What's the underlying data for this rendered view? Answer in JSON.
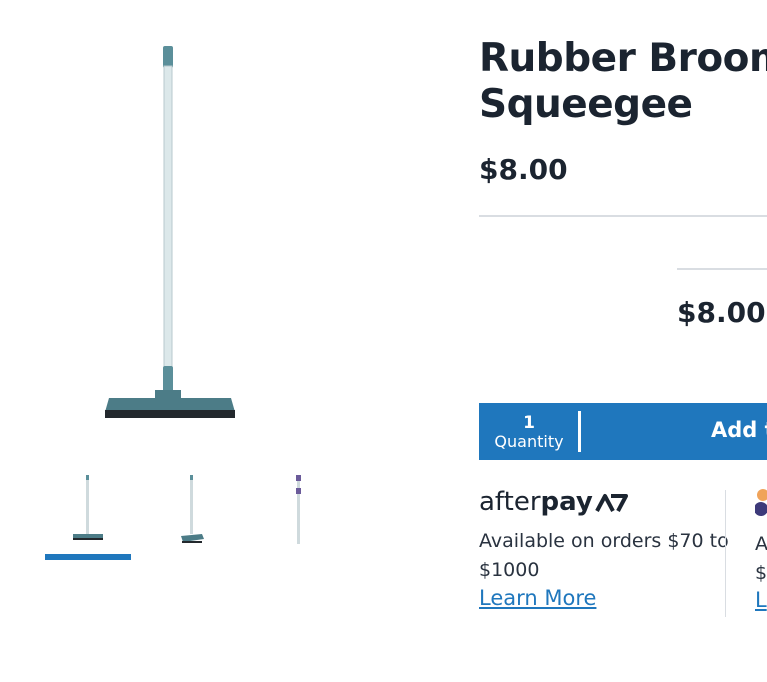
{
  "product": {
    "title_line1": "Rubber Broom",
    "title_line2": "Squeegee",
    "price": "$8.00"
  },
  "buy_box": {
    "price": "$8.00",
    "quantity_value": "1",
    "quantity_label": "Quantity",
    "add_label": "Add t"
  },
  "afterpay": {
    "logo_light": "after",
    "logo_bold": "pay",
    "text": "Available on orders $70 to $1000",
    "link": "Learn More"
  },
  "second_provider": {
    "text_line1": "A",
    "text_line2": "$",
    "link": "L"
  },
  "colors": {
    "accent": "#1f77bd",
    "text": "#1b2430",
    "broom": "#5b8f9a"
  },
  "gallery": {
    "thumbnail_count": 3,
    "selected_thumbnail": 1
  }
}
